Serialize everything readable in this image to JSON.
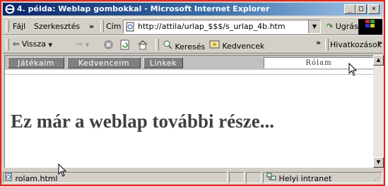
{
  "window": {
    "title": "4. példa: Weblap gombokkal - Microsoft Internet Explorer",
    "minimize_glyph": "_",
    "maximize_glyph": "□",
    "close_glyph": "×"
  },
  "menubar": {
    "file": "Fájl",
    "edit": "Szerkesztés",
    "overflow": "»",
    "address_label": "Cím",
    "address_value": "http://attila/urlap_$$$/s_urlap_4b.htm",
    "go_label": "Ugrás"
  },
  "toolbar": {
    "back_label": "Vissza",
    "search_label": "Keresés",
    "favorites_label": "Kedvencek",
    "overflow": "»",
    "links_label": "Hivatkozások"
  },
  "page": {
    "nav_buttons": [
      "Játékaim",
      "Kedvenceim",
      "Linkek"
    ],
    "active_button": "Rólam",
    "heading": "Ez már a weblap további része..."
  },
  "statusbar": {
    "left_text": "rolam.html",
    "zone_text": "Helyi intranet"
  },
  "colors": {
    "title_gradient_start": "#0a246a",
    "window_face": "#d4d0c8",
    "frame_accent": "#e0261e",
    "nav_button_face": "#808080",
    "heading_color": "#404040"
  }
}
